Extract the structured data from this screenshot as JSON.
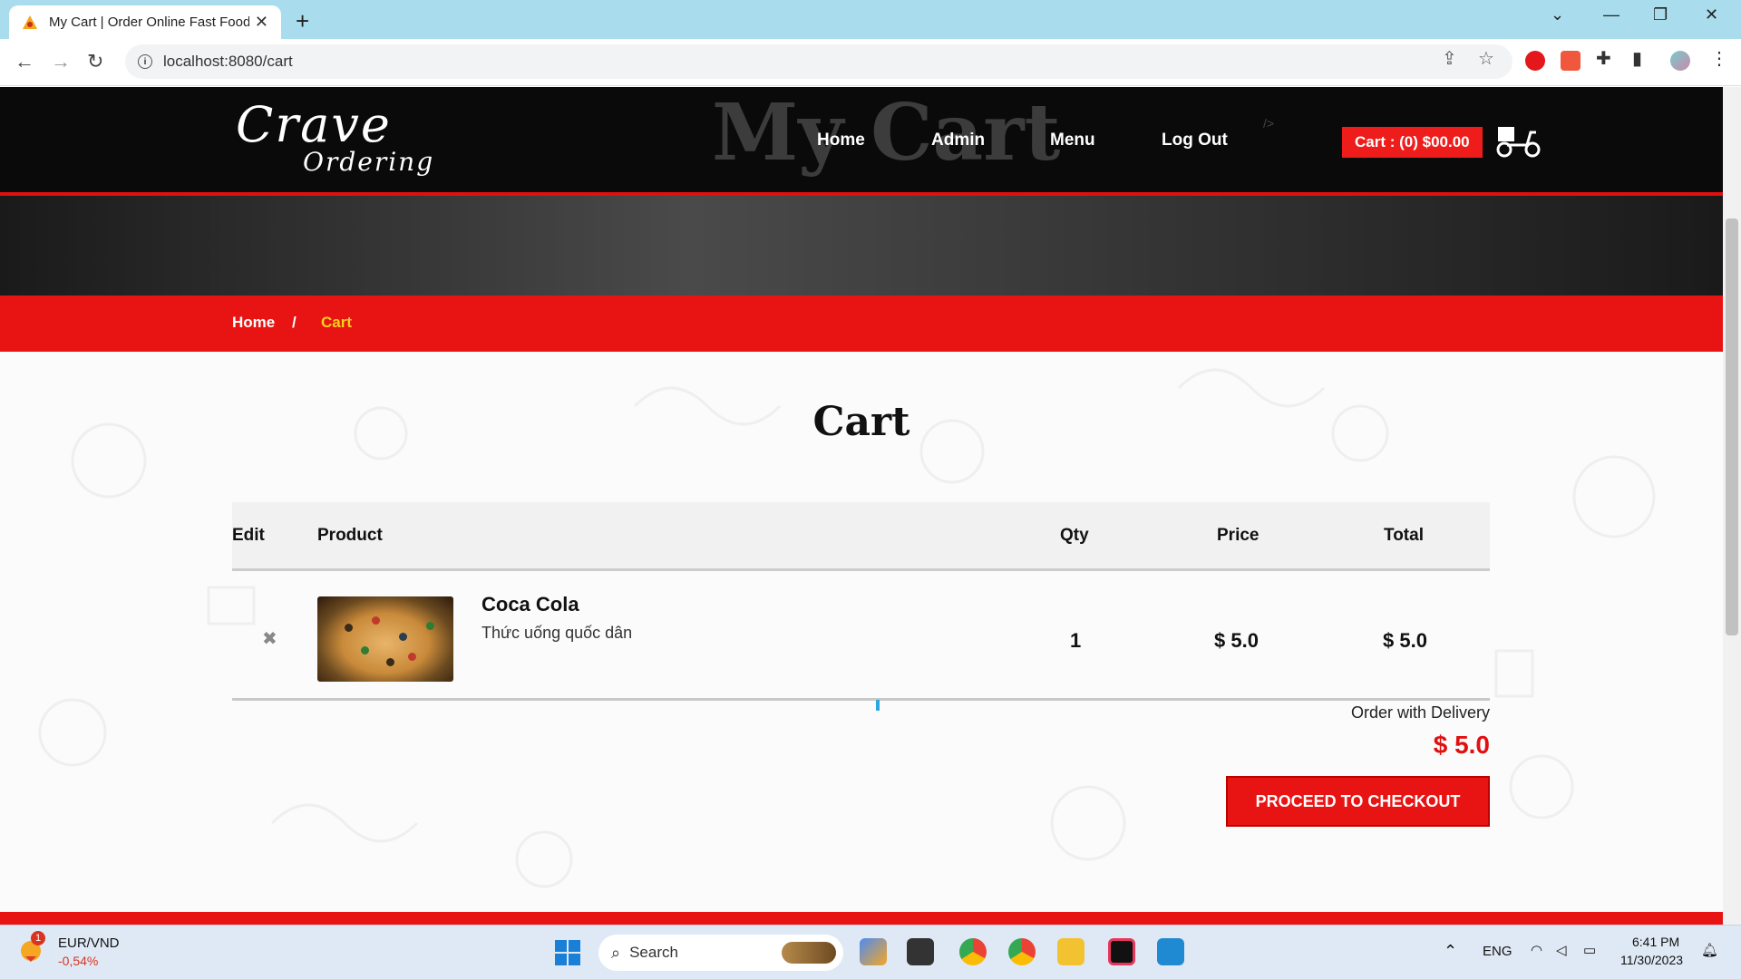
{
  "browser": {
    "tab_title": "My Cart | Order Online Fast Food",
    "url": "localhost:8080/cart"
  },
  "site": {
    "logo_line1": "Crave",
    "logo_line2": "Ordering",
    "hero_ghost_title": "My Cart",
    "nav": [
      "Home",
      "Admin",
      "Menu",
      "Log Out"
    ],
    "code_glyph": "/>",
    "cart_button": "Cart : (0) $00.00",
    "breadcrumb": {
      "home": "Home",
      "separator": "/",
      "current": "Cart"
    },
    "accent_color": "#e81414",
    "crumb_current_color": "#f7d11a"
  },
  "cart": {
    "title": "Cart",
    "columns": [
      "Edit",
      "Product",
      "Qty",
      "Price",
      "Total"
    ],
    "items": [
      {
        "name": "Coca Cola",
        "description": "Thức uống quốc dân",
        "qty": "1",
        "price": "$ 5.0",
        "total": "$ 5.0",
        "remove_icon": "close-icon"
      }
    ],
    "delivery_label": "Order with Delivery",
    "grand_total": "$ 5.0",
    "checkout_label": "PROCEED TO CHECKOUT"
  },
  "taskbar": {
    "widget_pair": "EUR/VND",
    "widget_change": "-0,54%",
    "widget_badge": "1",
    "search_placeholder": "Search",
    "lang": "ENG",
    "time": "6:41 PM",
    "date": "11/30/2023"
  }
}
